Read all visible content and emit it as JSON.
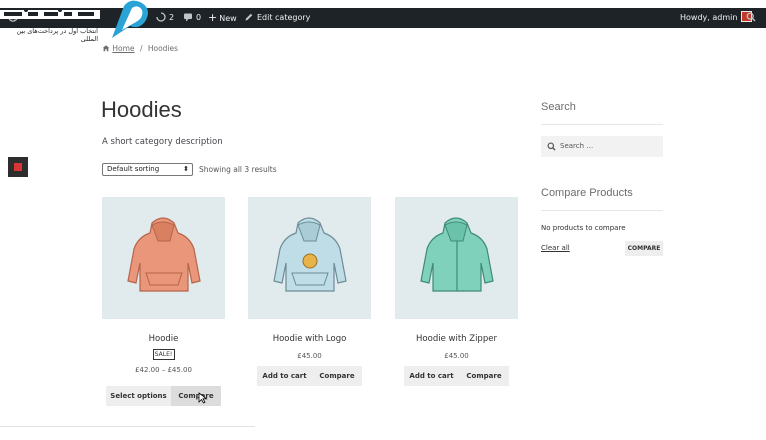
{
  "admin_bar": {
    "comments_count": "2",
    "pending_count": "0",
    "new_label": "New",
    "edit_label": "Edit category",
    "howdy": "Howdy, admin"
  },
  "watermark": {
    "tagline": "انتخاب اول در پرداخت‌های بین المللی"
  },
  "breadcrumb": {
    "home": "Home",
    "separator": "/",
    "current": "Hoodies"
  },
  "page": {
    "title": "Hoodies",
    "description": "A short category description",
    "sorting": "Default sorting",
    "result_count": "Showing all 3 results"
  },
  "products": [
    {
      "name": "Hoodie",
      "sale_badge": "SALE!",
      "price": "£42.00 – £45.00",
      "primary_button": "Select options",
      "compare_button": "Compare",
      "color": "#e9967a"
    },
    {
      "name": "Hoodie with Logo",
      "price": "£45.00",
      "primary_button": "Add to cart",
      "compare_button": "Compare",
      "color": "#bfdde6"
    },
    {
      "name": "Hoodie with Zipper",
      "price": "£45.00",
      "primary_button": "Add to cart",
      "compare_button": "Compare",
      "color": "#80d1bb"
    }
  ],
  "sidebar": {
    "search_title": "Search",
    "search_placeholder": "Search …",
    "compare_title": "Compare Products",
    "no_products": "No products to compare",
    "clear_all": "Clear all",
    "compare_button": "COMPARE"
  }
}
